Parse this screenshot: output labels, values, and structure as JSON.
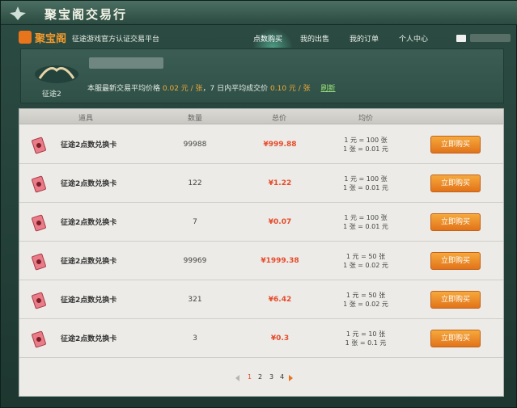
{
  "window": {
    "title": "聚宝阁交易行"
  },
  "nav": {
    "brand": "聚宝阁",
    "subtitle": "征途游戏官方认证交易平台",
    "tabs": [
      "点数购买",
      "我的出售",
      "我的订单",
      "个人中心"
    ],
    "active_tab": "点数购买"
  },
  "info": {
    "game_label": "征途2",
    "price_prefix": "本服最新交易平均价格",
    "avg_price": "0.02 元 / 张",
    "mid_text": "，7 日内平均成交价",
    "week_price": "0.10 元 / 张",
    "refresh_label": "刷新"
  },
  "table": {
    "headers": {
      "item": "道具",
      "qty": "数量",
      "total": "总价",
      "unit": "均价"
    },
    "rows": [
      {
        "name": "征途2点数兑换卡",
        "qty": "99988",
        "total": "¥999.88",
        "unit1": "1 元 = 100 张",
        "unit2": "1 张 = 0.01 元",
        "buy": "立即购买"
      },
      {
        "name": "征途2点数兑换卡",
        "qty": "122",
        "total": "¥1.22",
        "unit1": "1 元 = 100 张",
        "unit2": "1 张 = 0.01 元",
        "buy": "立即购买"
      },
      {
        "name": "征途2点数兑换卡",
        "qty": "7",
        "total": "¥0.07",
        "unit1": "1 元 = 100 张",
        "unit2": "1 张 = 0.01 元",
        "buy": "立即购买"
      },
      {
        "name": "征途2点数兑换卡",
        "qty": "99969",
        "total": "¥1999.38",
        "unit1": "1 元 = 50 张",
        "unit2": "1 张 = 0.02 元",
        "buy": "立即购买"
      },
      {
        "name": "征途2点数兑换卡",
        "qty": "321",
        "total": "¥6.42",
        "unit1": "1 元 = 50 张",
        "unit2": "1 张 = 0.02 元",
        "buy": "立即购买"
      },
      {
        "name": "征途2点数兑换卡",
        "qty": "3",
        "total": "¥0.3",
        "unit1": "1 元 = 10 张",
        "unit2": "1 张 = 0.1 元",
        "buy": "立即购买"
      }
    ]
  },
  "pager": {
    "pages": [
      "1",
      "2",
      "3",
      "4"
    ],
    "current": "1"
  }
}
